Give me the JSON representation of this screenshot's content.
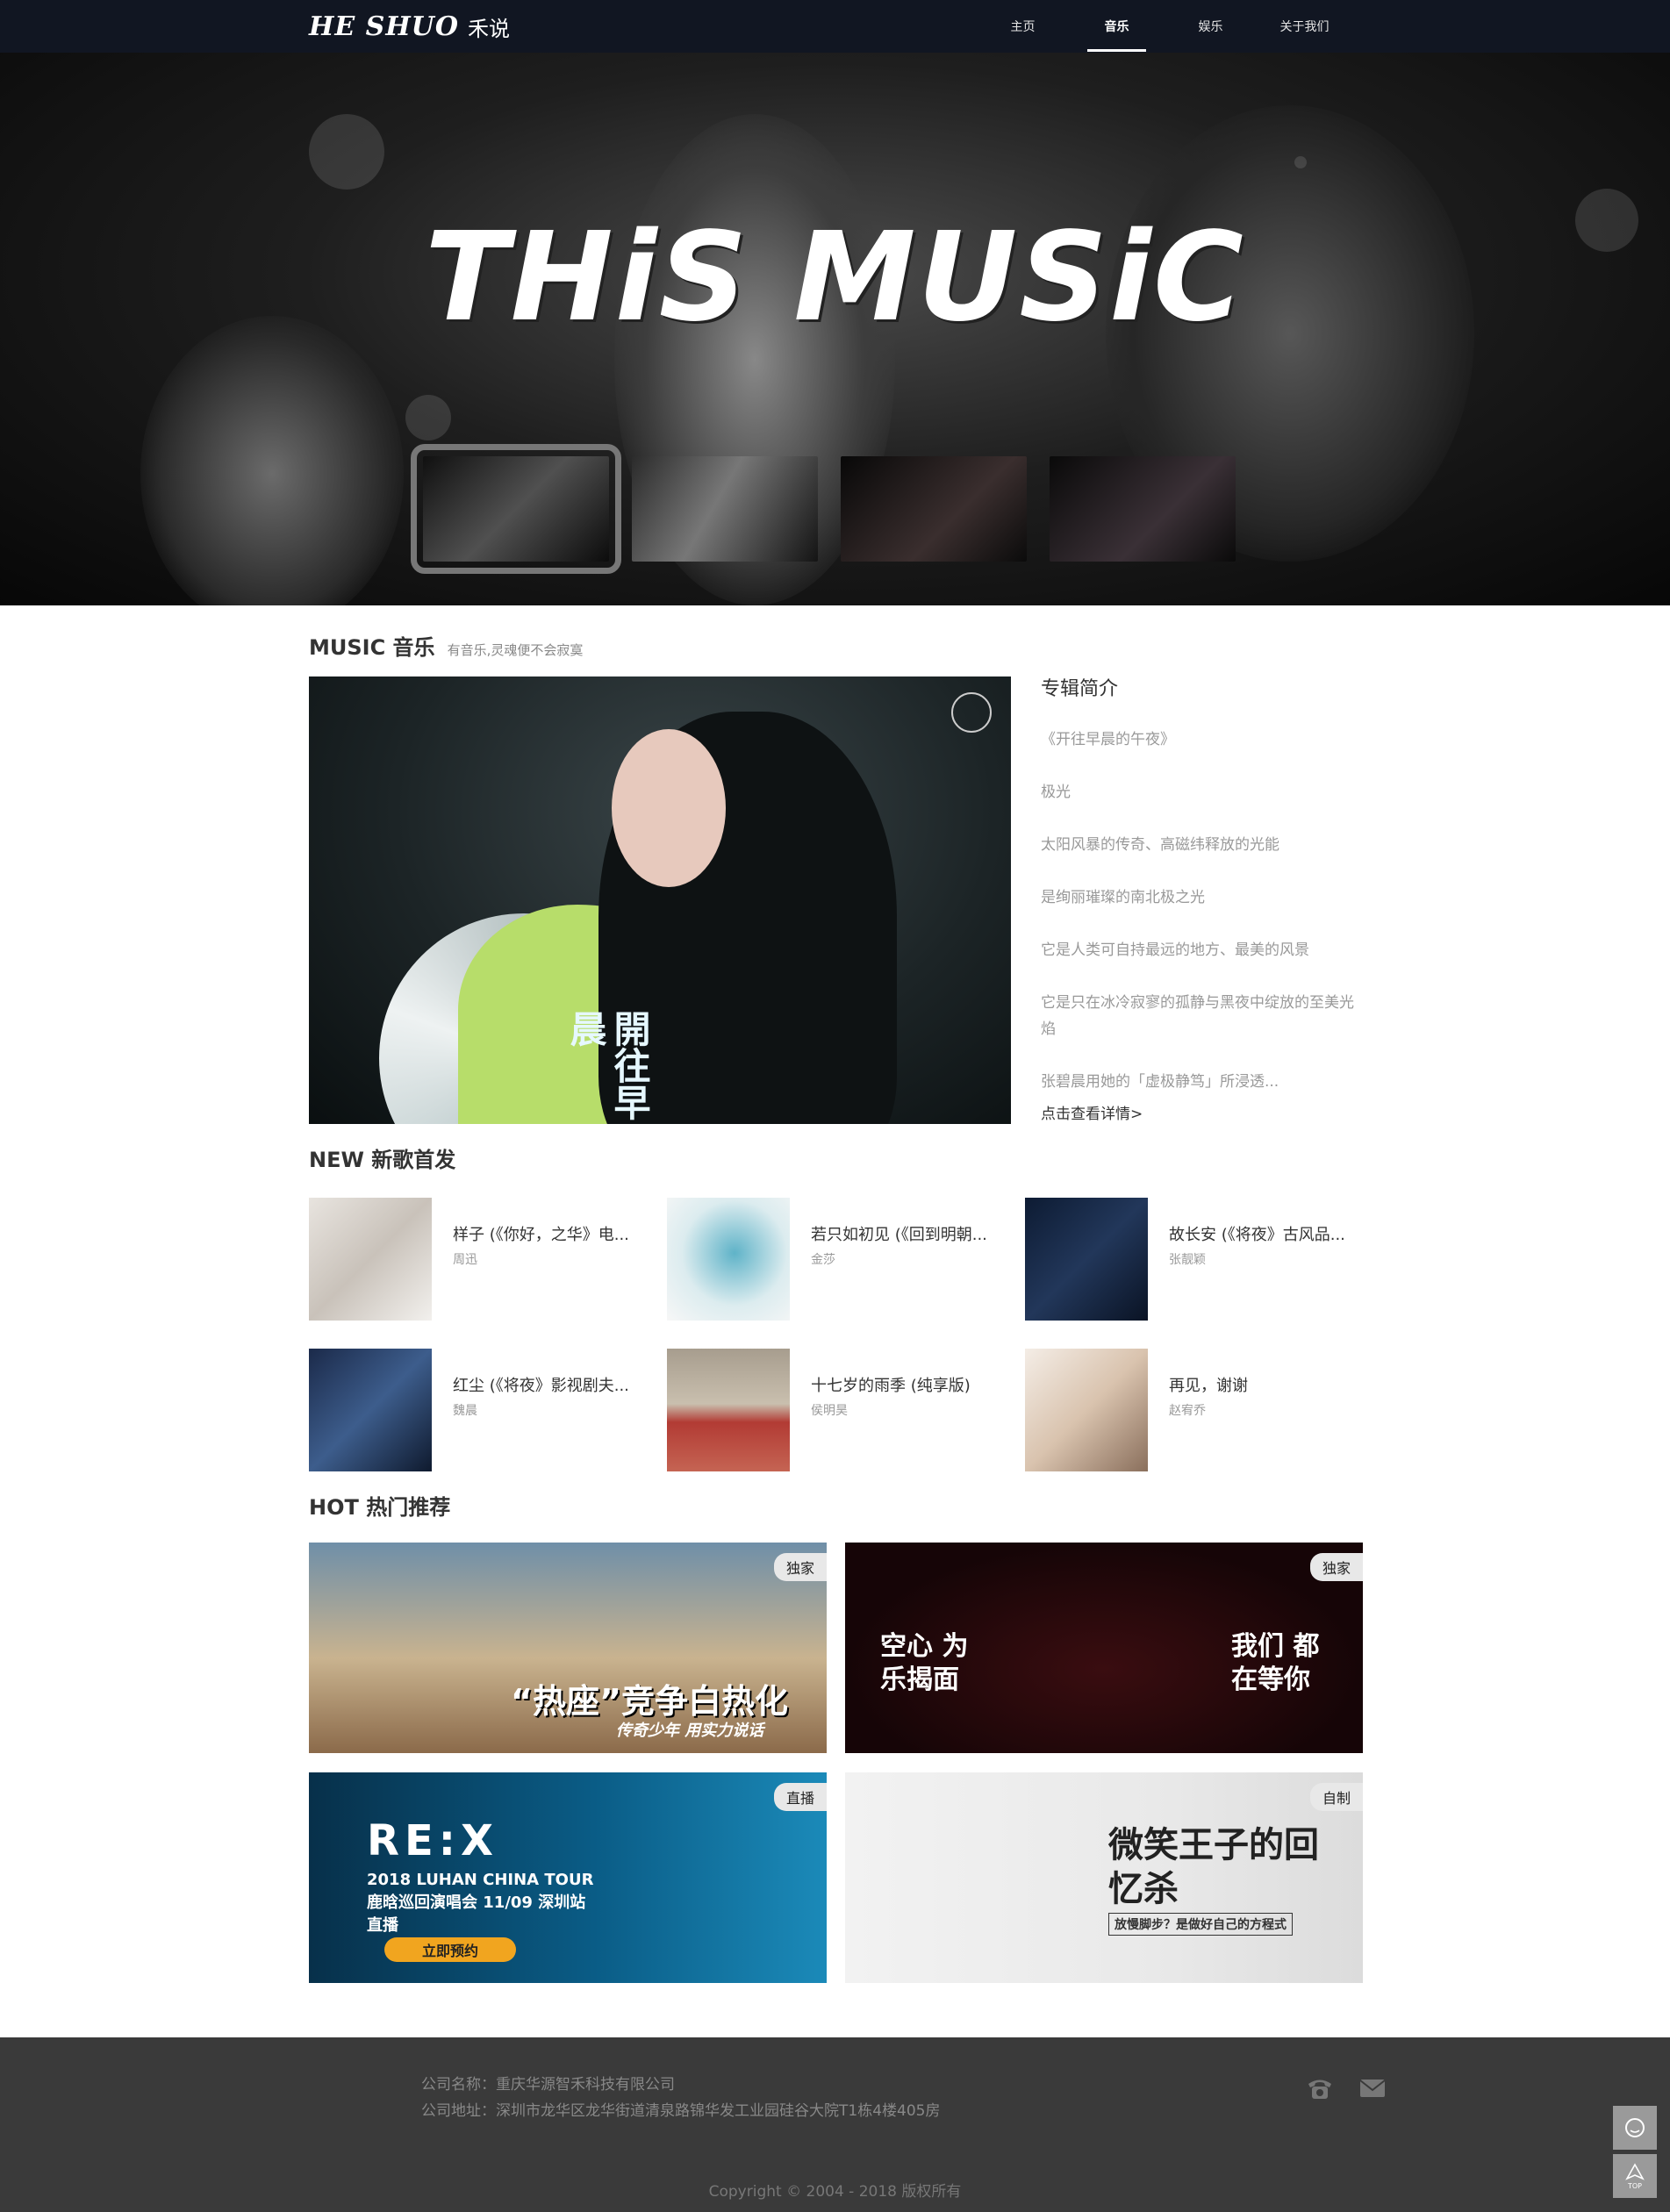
{
  "header": {
    "logo_en": "HE SHUO",
    "logo_cn": "禾说",
    "nav": [
      "主页",
      "音乐",
      "娱乐",
      "关于我们"
    ],
    "active_nav": "音乐"
  },
  "banner": {
    "title": "THiS MUSiC",
    "thumbnail_count": 4,
    "selected_thumbnail": 1
  },
  "music": {
    "title": "MUSIC 音乐",
    "subtitle": "有音乐,灵魂便不会寂寞",
    "cover_text": "開往早晨",
    "album": {
      "heading": "专辑简介",
      "lines": [
        "《开往早晨的午夜》",
        "极光",
        "太阳风暴的传奇、高磁纬释放的光能",
        "是绚丽璀璨的南北极之光",
        "它是人类可自持最远的地方、最美的风景",
        "它是只在冰冷寂寥的孤静与黑夜中绽放的至美光焰",
        "张碧晨用她的「虚极静笃」所浸透..."
      ],
      "more": "点击查看详情>"
    }
  },
  "new_songs": {
    "title": "NEW 新歌首发",
    "items": [
      {
        "name": "样子 (《你好，之华》电...",
        "artist": "周迅"
      },
      {
        "name": "若只如初见 (《回到明朝...",
        "artist": "金莎"
      },
      {
        "name": "故长安 (《将夜》古风品...",
        "artist": "张靓颖"
      },
      {
        "name": "红尘 (《将夜》影视剧夫...",
        "artist": "魏晨"
      },
      {
        "name": "十七岁的雨季 (纯享版)",
        "artist": "侯明昊"
      },
      {
        "name": "再见，谢谢",
        "artist": "赵宥乔"
      }
    ]
  },
  "hot": {
    "title": "HOT 热门推荐",
    "items": [
      {
        "tag": "独家",
        "text": "“热座”竞争白热化",
        "sub": "传奇少年  用实力说话"
      },
      {
        "tag": "独家",
        "text": "空心 为乐揭面",
        "sub": "我们 都在等你"
      },
      {
        "tag": "直播",
        "text": "RE:X",
        "sub": "2018 LUHAN CHINA TOUR 鹿晗巡回演唱会 11/09 深圳站直播",
        "button": "立即预约"
      },
      {
        "tag": "自制",
        "text": "微笑王子的回忆杀",
        "sub": "放慢脚步？是做好自己的方程式"
      }
    ]
  },
  "footer": {
    "company": "公司名称：重庆华源智禾科技有限公司",
    "address": "公司地址：深圳市龙华区龙华街道清泉路锦华发工业园硅谷大院T1栋4楼405房",
    "copyright": "Copyright © 2004 - 2018 版权所有",
    "icons": [
      "phone-icon",
      "mail-icon"
    ],
    "side_buttons": [
      "chat-icon",
      "top-icon"
    ],
    "top_label": "TOP"
  }
}
